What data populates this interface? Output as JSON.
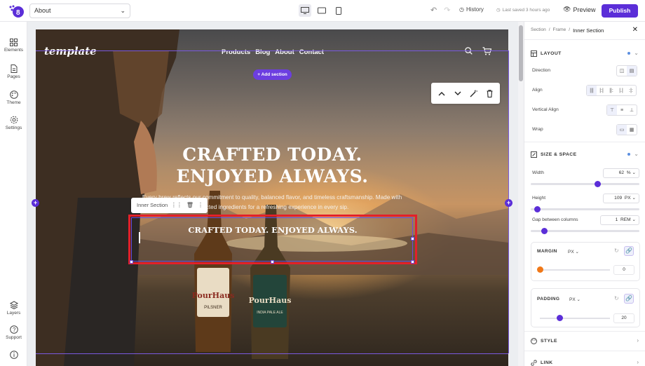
{
  "topbar": {
    "page_name": "About",
    "history_label": "History",
    "saved_label": "Last saved 3 hours ago",
    "preview_label": "Preview",
    "publish_label": "Publish"
  },
  "leftbar": {
    "elements": "Elements",
    "pages": "Pages",
    "theme": "Theme",
    "settings": "Settings",
    "layers": "Layers",
    "support": "Support"
  },
  "canvas": {
    "brand": "template",
    "nav": [
      "Products",
      "Blog",
      "About",
      "Contact"
    ],
    "add_section": "+ Add section",
    "headline_1": "CRAFTED TODAY.",
    "headline_2": "ENJOYED ALWAYS.",
    "paragraph_1": "Every brew reflects our commitment to quality, balanced flavor, and timeless craftsmanship. Made with",
    "paragraph_2": "selected ingredients for a refreshing experience in every sip.",
    "inner_section_label": "Inner Section",
    "inner_title": "CRAFTED TODAY. ENJOYED ALWAYS."
  },
  "panel": {
    "crumbs": [
      "Section",
      "/",
      "Frame",
      "/"
    ],
    "current": "Inner Section",
    "layout": {
      "title": "LAYOUT",
      "direction": "Direction",
      "align": "Align",
      "vertical_align": "Vertical Align",
      "wrap": "Wrap"
    },
    "size": {
      "title": "SIZE & SPACE",
      "width": "Width",
      "width_value": "62",
      "width_unit": "%",
      "height": "Height",
      "height_value": "109",
      "height_unit": "PX",
      "gap": "Gap between columns",
      "gap_value": "1",
      "gap_unit": "REM",
      "margin": "MARGIN",
      "margin_unit": "PX",
      "margin_value": "0",
      "padding": "PADDING",
      "padding_unit": "PX",
      "padding_value": "20"
    },
    "style": "STYLE",
    "link": "LINK"
  },
  "colors": {
    "accent": "#5b2ed8",
    "selection": "#e3202a",
    "margin_knob": "#f07818"
  }
}
